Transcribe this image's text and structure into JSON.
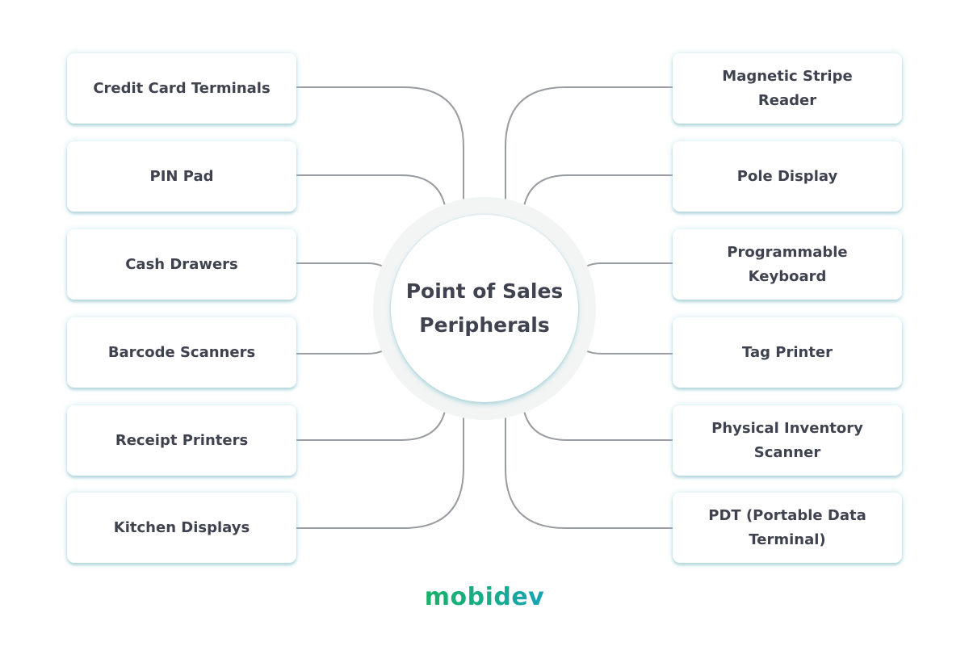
{
  "diagram": {
    "title": "Point of Sales Peripherals",
    "title_lines": [
      "Point of Sales",
      "Peripherals"
    ],
    "left_items": [
      {
        "label": "Credit Card Terminals"
      },
      {
        "label": "PIN Pad"
      },
      {
        "label": "Cash Drawers"
      },
      {
        "label": "Barcode Scanners"
      },
      {
        "label": "Receipt Printers"
      },
      {
        "label": "Kitchen Displays"
      }
    ],
    "right_items": [
      {
        "label": "Magnetic Stripe Reader"
      },
      {
        "label": "Pole Display"
      },
      {
        "label": "Programmable Keyboard"
      },
      {
        "label": "Tag Printer"
      },
      {
        "label": "Physical Inventory Scanner"
      },
      {
        "label": "PDT (Portable Data Terminal)"
      }
    ],
    "colors": {
      "text": "#3f4350",
      "connector": "#9a9ca3",
      "hub_ring": "#f3f5f5",
      "logo_start": "#17b26a",
      "logo_end": "#14a3b8"
    }
  },
  "brand": {
    "logo_text": "mobidev"
  }
}
